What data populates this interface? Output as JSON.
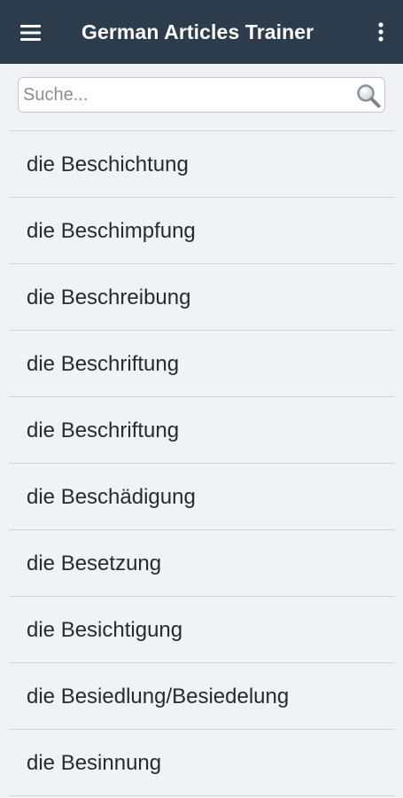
{
  "app": {
    "title": "German Articles Trainer",
    "colors": {
      "topbar": "#2d3c4c",
      "background": "#f0f2f5",
      "text": "#262b31",
      "divider": "#cfd3d8"
    }
  },
  "toolbar": {
    "menu_icon": "hamburger-menu-icon",
    "overflow_icon": "more-vertical-icon"
  },
  "search": {
    "placeholder": "Suche...",
    "value": "",
    "icon": "magnifier-icon"
  },
  "words": [
    {
      "label": "die Beschichtung"
    },
    {
      "label": "die Beschimpfung"
    },
    {
      "label": "die Beschreibung"
    },
    {
      "label": "die Beschriftung"
    },
    {
      "label": "die Beschriftung"
    },
    {
      "label": "die Beschädigung"
    },
    {
      "label": "die Besetzung"
    },
    {
      "label": "die Besichtigung"
    },
    {
      "label": "die Besiedlung/Besiedelung"
    },
    {
      "label": "die Besinnung"
    }
  ]
}
